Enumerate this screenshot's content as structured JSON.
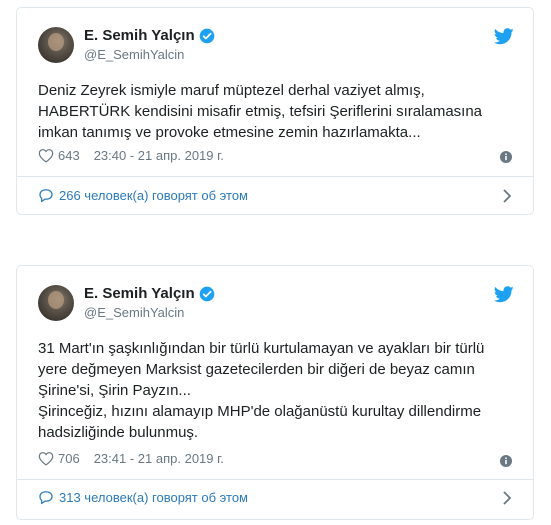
{
  "colors": {
    "link": "#2b7bb9",
    "secondary": "#697882",
    "border": "#e1e8ed",
    "verified": "#1da1f2",
    "twitter_blue": "#1da1f2"
  },
  "tweets": [
    {
      "author_name": "E. Semih Yalçın",
      "handle": "@E_SemihYalcin",
      "text": "Deniz Zeyrek ismiyle maruf müptezel derhal vaziyet almış,\nHABERTÜRK kendisini misafir etmiş, tefsiri Şeriflerini sıralamasına\nimkan tanımış ve provoke etmesine zemin hazırlamakta...",
      "likes": "643",
      "timestamp": "23:40 - 21 апр. 2019 г.",
      "conversation": "266 человек(а) говорят об этом",
      "icons": [
        "heart-icon",
        "info-icon",
        "speech-bubble-icon",
        "chevron-right-icon",
        "verified-badge-icon",
        "twitter-bird-icon"
      ]
    },
    {
      "author_name": "E. Semih Yalçın",
      "handle": "@E_SemihYalcin",
      "text": "31 Mart'ın şaşkınlığından bir türlü kurtulamayan ve ayakları bir türlü\nyere değmeyen Marksist gazetecilerden bir diğeri de beyaz camın\nŞirine'si, Şirin Payzın...\nŞirinceğiz, hızını alamayıp MHP'de olağanüstü kurultay dillendirme\nhadsizliğinde bulunmuş.",
      "likes": "706",
      "timestamp": "23:41 - 21 апр. 2019 г.",
      "conversation": "313 человек(а) говорят об этом",
      "icons": [
        "heart-icon",
        "info-icon",
        "speech-bubble-icon",
        "chevron-right-icon",
        "verified-badge-icon",
        "twitter-bird-icon"
      ]
    }
  ]
}
